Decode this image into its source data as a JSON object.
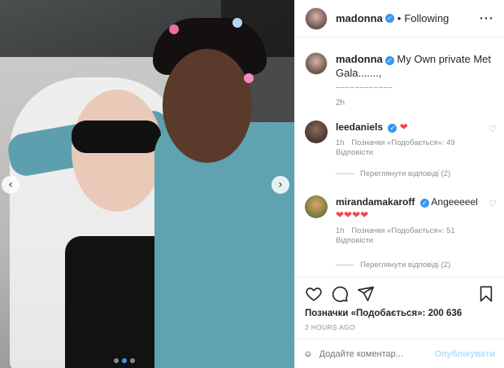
{
  "post": {
    "username": "madonna",
    "separator": "•",
    "follow_status": "Following",
    "more_icon": "more-options-icon",
    "caption_text": "My Own private Met Gala.......,",
    "caption_line2": "~~~~~~~~~~~~",
    "caption_time": "2h"
  },
  "comments": [
    {
      "username": "leedaniels",
      "text": "❤",
      "time": "1h",
      "likes_label": "Позначки «Подобається»: 49",
      "reply_label": "Відповісти",
      "view_replies": "Переглянути відповіді (2)"
    },
    {
      "username": "mirandamakaroff",
      "text": "Angeeeeel",
      "text_line2": "❤❤❤❤",
      "time": "1h",
      "likes_label": "Позначки «Подобається»: 51",
      "reply_label": "Відповісти",
      "view_replies": "Переглянути відповіді (2)"
    }
  ],
  "footer": {
    "likes_prefix": "Позначки «Подобається»:",
    "likes_count": "200 636",
    "posted_ago": "2 HOURS AGO",
    "comment_placeholder": "Додайте коментар...",
    "publish_label": "Опублікувати"
  },
  "colors": {
    "accent": "#3897f0",
    "heart": "#ed4956",
    "publish_disabled": "#b2dffc"
  },
  "carousel": {
    "prev_icon": "chevron-left-icon",
    "next_icon": "chevron-right-icon",
    "prev_glyph": "‹",
    "next_glyph": "›"
  }
}
